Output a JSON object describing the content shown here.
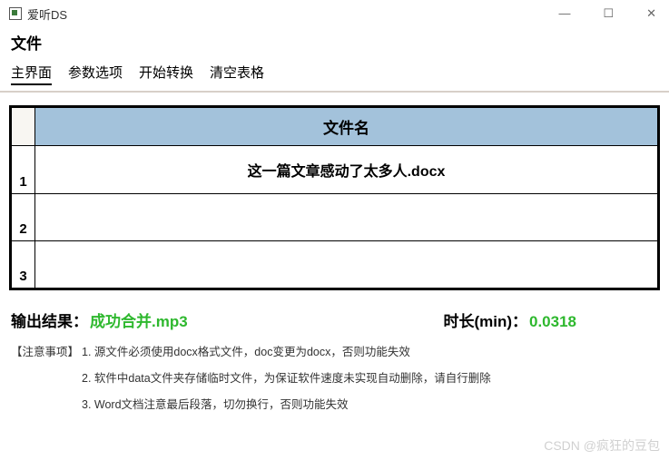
{
  "titlebar": {
    "title": "爱听DS"
  },
  "section_title": "文件",
  "menu": {
    "items": [
      "主界面",
      "参数选项",
      "开始转换",
      "清空表格"
    ],
    "active_index": 0
  },
  "table": {
    "header": "文件名",
    "rows": [
      {
        "num": "1",
        "name": "这一篇文章感动了太多人.docx"
      },
      {
        "num": "2",
        "name": ""
      },
      {
        "num": "3",
        "name": ""
      }
    ]
  },
  "output": {
    "label": "输出结果：",
    "value": "成功合并.mp3",
    "duration_label": "时长(min)：",
    "duration_value": "0.0318"
  },
  "notes": {
    "label": "【注意事项】",
    "items": [
      "1. 源文件必须使用docx格式文件，doc变更为docx，否则功能失效",
      "2. 软件中data文件夹存储临时文件，为保证软件速度未实现自动删除，请自行删除",
      "3. Word文档注意最后段落，切勿换行，否则功能失效"
    ]
  },
  "watermark": "CSDN @疯狂的豆包"
}
